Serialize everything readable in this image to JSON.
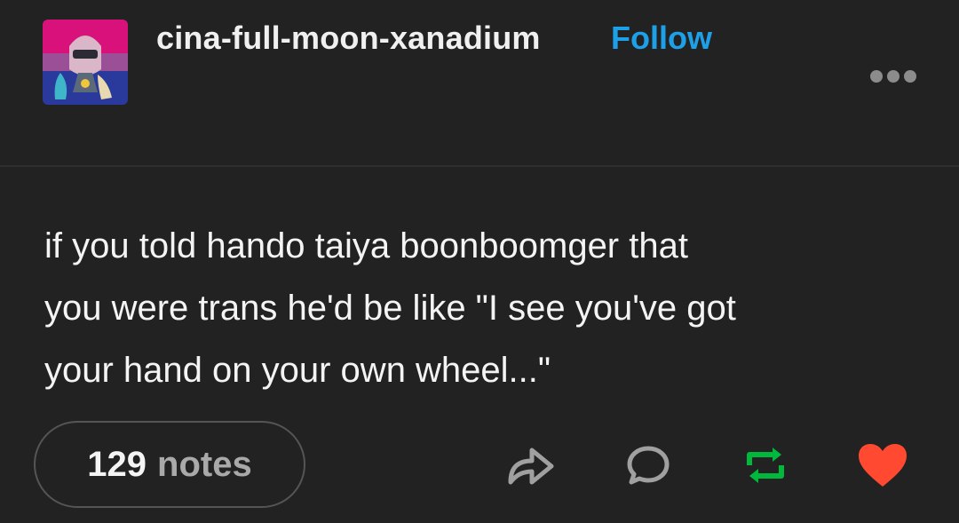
{
  "post": {
    "username": "cina-full-moon-xanadium",
    "follow_label": "Follow",
    "body_lines": [
      "if you told hando taiya boonboomger that",
      "you were trans he'd be like \"I see you've got",
      "your hand on your own wheel...\""
    ]
  },
  "footer": {
    "notes_count": "129",
    "notes_label": "notes"
  },
  "icons": {
    "avatar": "avatar-image",
    "more": "more-icon",
    "share": "share-icon",
    "reply": "reply-icon",
    "reblog": "reblog-icon",
    "like": "heart-icon"
  },
  "colors": {
    "background": "#222222",
    "follow": "#1ea0e8",
    "reblog": "#00b83c",
    "like": "#ff4930",
    "icon_neutral": "#a0a0a0"
  }
}
